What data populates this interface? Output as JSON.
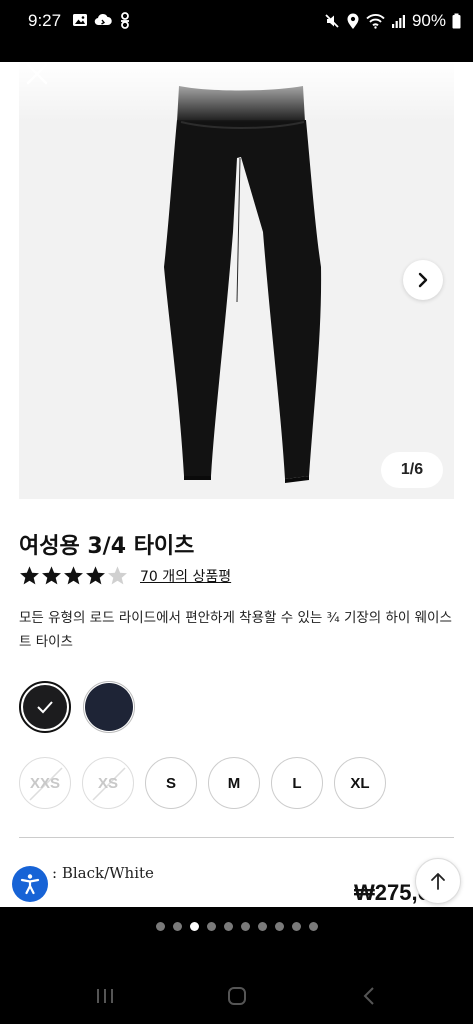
{
  "status_bar": {
    "time": "9:27",
    "battery_percent": "90%",
    "left_icons": [
      "image-icon",
      "cloud-icon",
      "link-icon"
    ],
    "right_icons": [
      "mute-icon",
      "location-icon",
      "wifi-icon",
      "signal-icon",
      "battery-icon"
    ]
  },
  "gallery": {
    "counter": "1/6",
    "current_index": 1,
    "total": 6
  },
  "product": {
    "title": "여성용 3/4 타이츠",
    "rating": 4,
    "rating_max": 5,
    "reviews_label": "70 개의 상품평",
    "description": "모든 유형의 로드 라이드에서 편안하게 착용할 수 있는 ¾ 기장의 하이 웨이스트 타이츠",
    "color_partial": ": Black/White",
    "price_partial": "₩275,0"
  },
  "colors": [
    {
      "name": "black",
      "hex": "#1c1c1e",
      "selected": true
    },
    {
      "name": "navy",
      "hex": "#1e2436",
      "selected": false
    }
  ],
  "sizes": [
    {
      "label": "XXS",
      "available": false
    },
    {
      "label": "XS",
      "available": false
    },
    {
      "label": "S",
      "available": true
    },
    {
      "label": "M",
      "available": true
    },
    {
      "label": "L",
      "available": true
    },
    {
      "label": "XL",
      "available": true
    }
  ],
  "pager": {
    "count": 10,
    "active_index": 2
  },
  "theme": {
    "accent_blue": "#1763d6",
    "text": "#111111"
  }
}
